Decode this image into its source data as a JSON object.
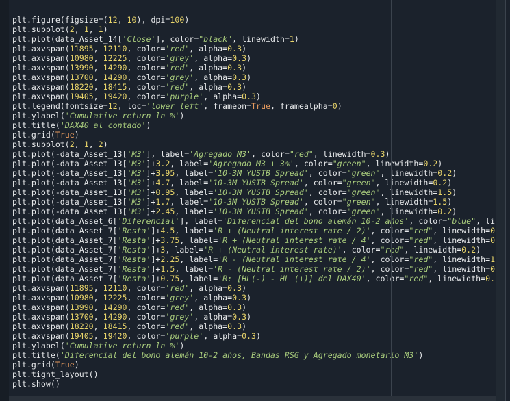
{
  "editor": {
    "language": "python",
    "lines": [
      "plt.figure(figsize=(12, 10), dpi=100)",
      "plt.subplot(2, 1, 1)",
      "plt.plot(data_Asset_14['Close'], color=\"black\", linewidth=1)",
      "plt.axvspan(11895, 12110, color='red', alpha=0.3)",
      "plt.axvspan(10980, 12225, color='grey', alpha=0.3)",
      "plt.axvspan(13990, 14290, color='red', alpha=0.3)",
      "plt.axvspan(13700, 14290, color='grey', alpha=0.3)",
      "plt.axvspan(18220, 18415, color='red', alpha=0.3)",
      "plt.axvspan(19405, 19420, color='purple', alpha=0.3)",
      "plt.legend(fontsize=12, loc='lower left', frameon=True, framealpha=0)",
      "plt.ylabel('Cumulative return ln %')",
      "plt.title('DAX40 al contado')",
      "plt.grid(True)",
      "plt.subplot(2, 1, 2)",
      "plt.plot(-data_Asset_13['M3'], label='Agregado M3', color=\"red\", linewidth=0.3)",
      "plt.plot(-data_Asset_13['M3']+3.2, label='Agregado M3 + 3%', color=\"green\", linewidth=0.2)",
      "plt.plot(-data_Asset_13['M3']+3.95, label='10-3M YUSTB Spread', color=\"green\", linewidth=0.2)",
      "plt.plot(-data_Asset_13['M3']+4.7, label='10-3M YUSTB Spread', color=\"green\", linewidth=0.2)",
      "plt.plot(-data_Asset_13['M3']+0.95, label='10-3M YUSTB Spread', color=\"green\", linewidth=1.5)",
      "plt.plot(-data_Asset_13['M3']+1.7, label='10-3M YUSTB Spread', color=\"green\", linewidth=1.5)",
      "plt.plot(-data_Asset_13['M3']+2.45, label='10-3M YUSTB Spread', color=\"green\", linewidth=0.2)",
      "plt.plot(data_Asset_6['Diferencial'], label='Diferencial del bono alemán 10-2 años', color=\"blue\", li",
      "plt.plot(data_Asset_7['Resta']+4.5, label='R + (Neutral interest rate / 2)', color=\"red\", linewidth=0",
      "plt.plot(data_Asset_7['Resta']+3.75, label='R + (Neutral interest rate / 4', color=\"red\", linewidth=0",
      "plt.plot(data_Asset_7['Resta']+3, label='R + (Neutral interest rate)', color=\"red\", linewidth=0.2)",
      "plt.plot(data_Asset_7['Resta']+2.25, label='R - (Neutral interest rate / 4', color=\"red\", linewidth=1",
      "plt.plot(data_Asset_7['Resta']+1.5, label='R - (Neutral interest rate / 2)', color=\"red\", linewidth=0",
      "plt.plot(data_Asset_7['Resta']+0.75, label='R: [HL(-) - HL (+)] del DAX40', color=\"red\", linewidth=0.",
      "plt.axvspan(11895, 12110, color='red', alpha=0.3)",
      "plt.axvspan(10980, 12225, color='grey', alpha=0.3)",
      "plt.axvspan(13990, 14290, color='red', alpha=0.3)",
      "plt.axvspan(13700, 14290, color='grey', alpha=0.3)",
      "plt.axvspan(18220, 18415, color='red', alpha=0.3)",
      "plt.axvspan(19405, 19420, color='purple', alpha=0.3)",
      "plt.ylabel('Cumulative return ln %')",
      "plt.title('Diferencial del bono alemán 10-2 años, Bandas RSG y Agregado monetario M3')",
      "plt.grid(True)",
      "plt.tight_layout()",
      "plt.show()"
    ]
  },
  "theme": {
    "background": "#1b222c",
    "text": "#e6e8ea",
    "string": "#a8cb7c",
    "number": "#e8d46a",
    "keyword": "#e59a5e"
  }
}
